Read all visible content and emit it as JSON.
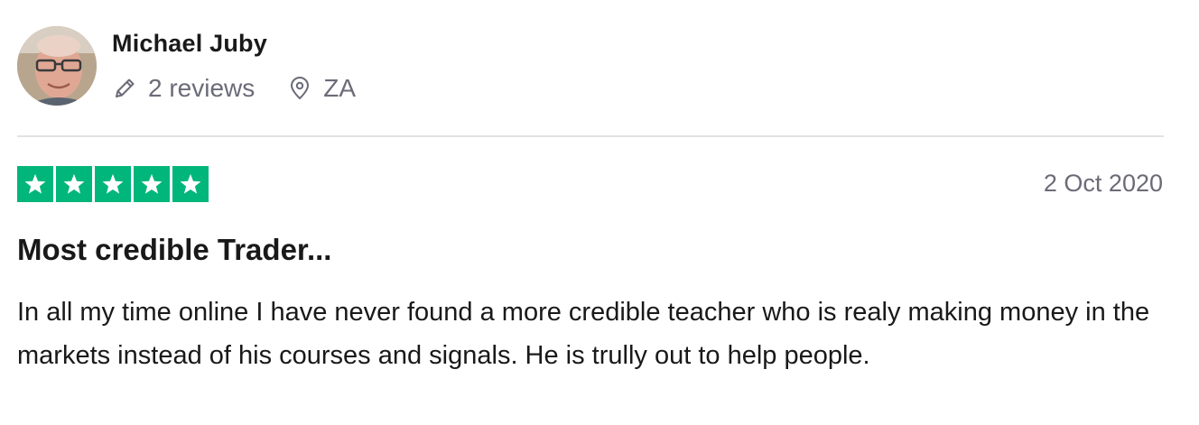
{
  "reviewer": {
    "name": "Michael Juby",
    "reviews_count": "2 reviews",
    "country": "ZA",
    "avatar_icon": "user-photo"
  },
  "review": {
    "rating": 5,
    "rating_max": 5,
    "star_color": "#00b67a",
    "date": "2 Oct 2020",
    "title": "Most credible Trader...",
    "body": "In all my time online I have never found a more credible teacher who is realy making money in the markets instead of his courses and signals. He is trully out to help people."
  },
  "icons": {
    "reviews": "pencil-icon",
    "location": "location-pin-icon",
    "star": "star-icon"
  },
  "colors": {
    "text_primary": "#191919",
    "text_secondary": "#6b6b78",
    "divider": "#e2e2e2"
  }
}
